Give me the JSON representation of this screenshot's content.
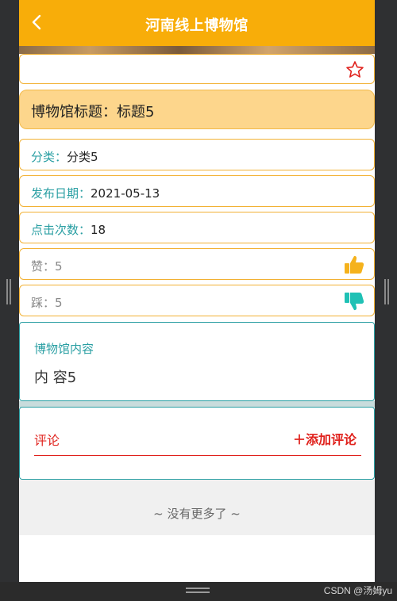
{
  "header": {
    "title": "河南线上博物馆"
  },
  "detail": {
    "title_label": "博物馆标题：",
    "title_value": "标题5",
    "category_label": "分类：",
    "category_value": "分类5",
    "date_label": "发布日期：",
    "date_value": "2021-05-13",
    "clicks_label": "点击次数：",
    "clicks_value": "18",
    "like_label": "赞：",
    "like_value": "5",
    "dislike_label": "踩：",
    "dislike_value": "5"
  },
  "content": {
    "section_label": "博物馆内容",
    "body": "内 容5"
  },
  "comments": {
    "label": "评论",
    "add_label": "＋添加评论"
  },
  "footer": {
    "no_more": "~ 没有更多了 ~"
  },
  "watermark": "CSDN @汤姆yu",
  "icons": {
    "back": "back-arrow-icon",
    "favorite": "star-outline-icon",
    "like": "thumbs-up-icon",
    "dislike": "thumbs-down-icon"
  },
  "colors": {
    "header": "#f8ad09",
    "accent_teal": "#2a9fa3",
    "accent_red": "#e0211c",
    "like": "#f5b21c",
    "dislike": "#1fc1b5"
  }
}
